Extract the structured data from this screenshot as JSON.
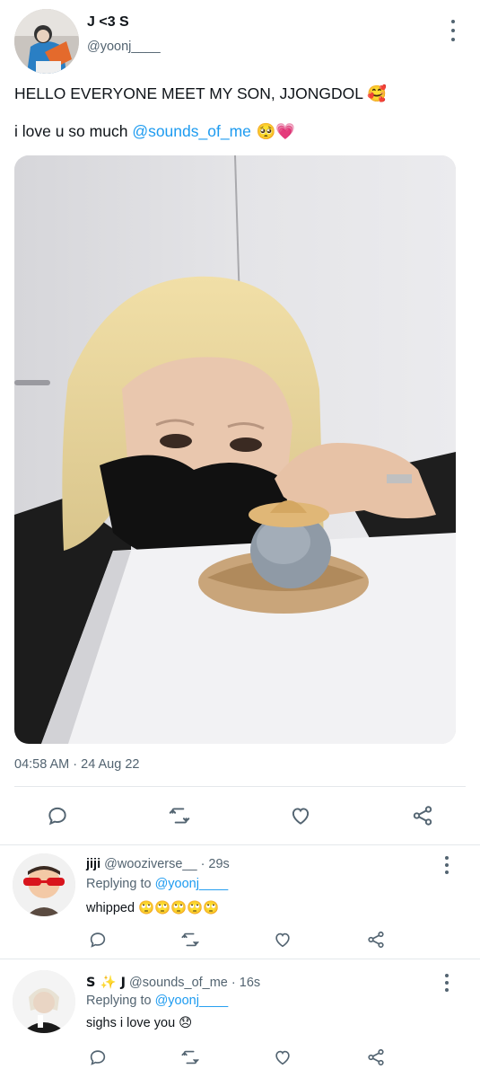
{
  "tweet": {
    "author_name": "J <3 S",
    "author_handle": "@yoonj____",
    "line1": "HELLO EVERYONE MEET MY SON, JJONGDOL 🥰",
    "line2_text": "i love u so much ",
    "line2_mention": "@sounds_of_me",
    "line2_emoji": " 🥺💗",
    "timestamp": "04:58 AM · 24 Aug 22",
    "icons": [
      "more-vertical-icon",
      "reply-icon",
      "retweet-icon",
      "like-icon",
      "share-icon"
    ]
  },
  "replies": [
    {
      "name": "jiji",
      "handle": "@wooziverse__",
      "time": " · 29s",
      "replying_label": "Replying to ",
      "replying_handle": "@yoonj____",
      "text": "whipped ",
      "emoji": "🙄🙄🙄🙄🙄"
    },
    {
      "name": "S ✨ J",
      "handle": "@sounds_of_me",
      "time": " · 16s",
      "replying_label": "Replying to ",
      "replying_handle": "@yoonj____",
      "text": "sighs i love you ",
      "emoji": "😞"
    }
  ],
  "colors": {
    "accent": "#1d9bf0",
    "secondary_text": "#536471",
    "divider": "#e4e8eb"
  }
}
